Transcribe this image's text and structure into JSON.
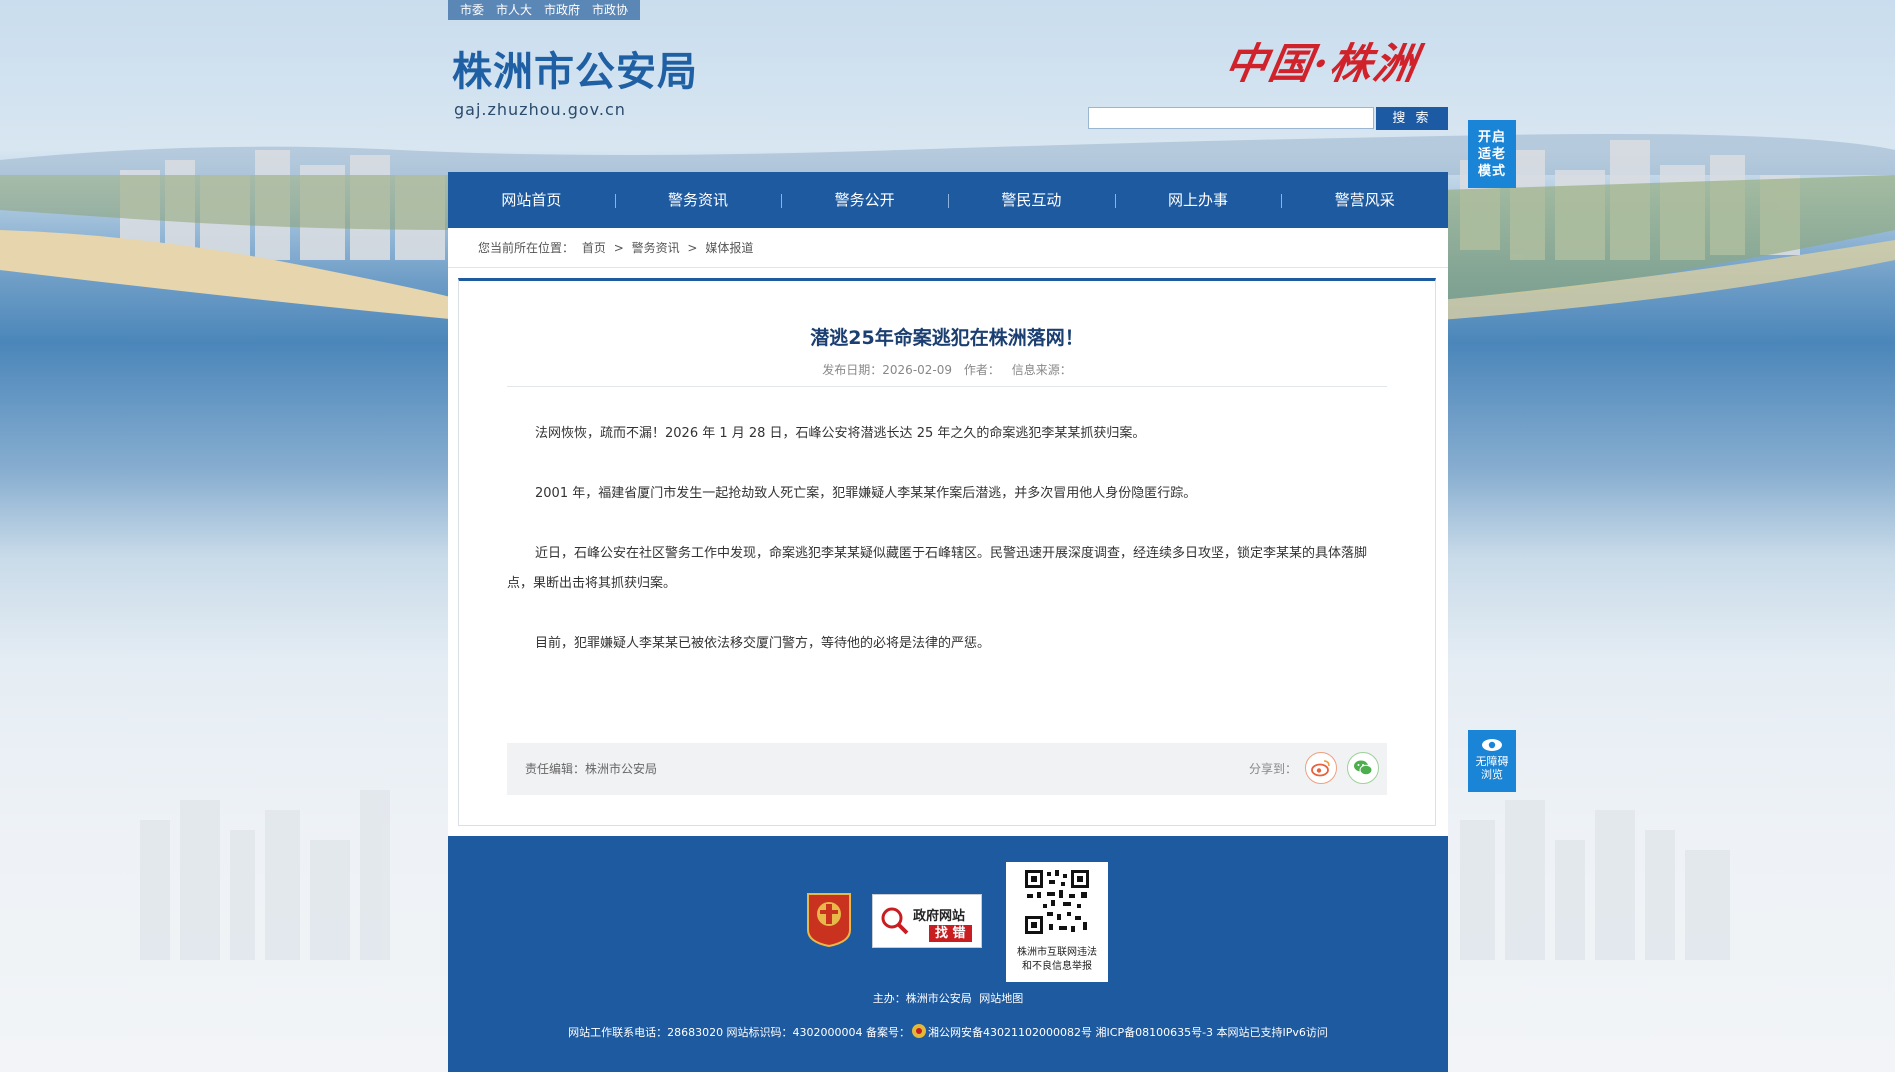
{
  "top_links": [
    "市委",
    "市人大",
    "市政府",
    "市政协"
  ],
  "header": {
    "title": "株洲市公安局",
    "domain": "gaj.zhuzhou.gov.cn",
    "logo_text": "中国·株洲",
    "search_placeholder": "",
    "search_button": "搜 索"
  },
  "nav": [
    "网站首页",
    "警务资讯",
    "警务公开",
    "警民互动",
    "网上办事",
    "警营风采"
  ],
  "breadcrumb": {
    "prefix": "您当前所在位置：",
    "items": [
      "首页",
      "警务资讯",
      "媒体报道"
    ],
    "separator": ">"
  },
  "article": {
    "title": "潜逃25年命案逃犯在株洲落网！",
    "date_label": "发布日期：2026-02-09",
    "author_label": "作者：",
    "source_label": "信息来源：",
    "paragraphs": [
      "法网恢恢，疏而不漏！2026 年 1 月 28 日，石峰公安将潜逃长达 25 年之久的命案逃犯李某某抓获归案。",
      "2001 年，福建省厦门市发生一起抢劫致人死亡案，犯罪嫌疑人李某某作案后潜逃，并多次冒用他人身份隐匿行踪。",
      "近日，石峰公安在社区警务工作中发现，命案逃犯李某某疑似藏匿于石峰辖区。民警迅速开展深度调查，经连续多日攻坚，锁定李某某的具体落脚点，果断出击将其抓获归案。",
      "目前，犯罪嫌疑人李某某已被依法移交厦门警方，等待他的必将是法律的严惩。"
    ],
    "editor": "责任编辑：株洲市公安局",
    "share_label": "分享到："
  },
  "footer": {
    "party_badge_text": "党政机关",
    "error_badge": {
      "line1": "政府网站",
      "line2": "找 错"
    },
    "qr_caption": [
      "株洲市互联网违法",
      "和不良信息举报"
    ],
    "sponsor_label": "主办：株洲市公安局",
    "sitemap_link": "网站地图",
    "contact_prefix": "网站工作联系电话：28683020 网站标识码：4302000004 备案号：",
    "contact_suffix": "湘公网安备43021102000082号 湘ICP备08100635号-3 本网站已支持IPv6访问"
  },
  "side": {
    "elder_mode": [
      "开启",
      "适老",
      "模式"
    ],
    "accessible": [
      "无障碍",
      "浏览"
    ]
  },
  "colors": {
    "primary": "#1e5aa0",
    "accent_red": "#c81e22",
    "side_button": "#1a84d6"
  }
}
